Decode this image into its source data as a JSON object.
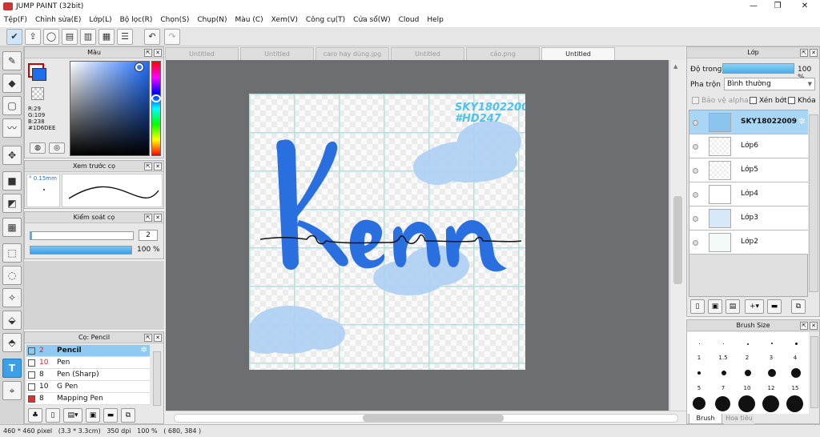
{
  "app": {
    "title": "JUMP PAINT (32bit)"
  },
  "menu": [
    "Tệp(F)",
    "Chỉnh sửa(E)",
    "Lớp(L)",
    "Bộ lọc(R)",
    "Chọn(S)",
    "Chụp(N)",
    "Màu (C)",
    "Xem(V)",
    "Công cụ(T)",
    "Cửa sổ(W)",
    "Cloud",
    "Help"
  ],
  "color_panel": {
    "title": "Màu",
    "r": "R:29",
    "g": "G:109",
    "b": "B:238",
    "hex": "#1D6DEE",
    "fg_color": "#1D6DEE",
    "bg_color": "#E23A3A"
  },
  "brush_preview": {
    "title": "Xem trước cọ",
    "size": "° 0.15mm"
  },
  "brush_control": {
    "title": "Kiểm soát cọ",
    "size_value": "2",
    "opacity_label": "100 %",
    "opacity_fraction": 1.0
  },
  "brush_list": {
    "title": "Cọ: Pencil",
    "items": [
      {
        "size": "2",
        "name": "Pencil",
        "color": "#333333",
        "selected": true
      },
      {
        "size": "10",
        "name": "Pen",
        "color": "#333333",
        "selected": false
      },
      {
        "size": "8",
        "name": "Pen (Sharp)",
        "color": "#333333",
        "selected": false
      },
      {
        "size": "10",
        "name": "G Pen",
        "color": "#333333",
        "selected": false
      },
      {
        "size": "8",
        "name": "Mapping Pen",
        "color": "#e03030",
        "selected": false
      }
    ]
  },
  "tabs": [
    {
      "label": "Untitled",
      "active": false
    },
    {
      "label": "Untitled",
      "active": false
    },
    {
      "label": "caro hay dùng.jpg",
      "active": false
    },
    {
      "label": "Untitled",
      "active": false
    },
    {
      "label": "cáo.png",
      "active": false
    },
    {
      "label": "Untitled",
      "active": true
    }
  ],
  "canvas_art": {
    "watermark_line1": "SKY18022009",
    "watermark_line2": "#HD247",
    "word": "Ken"
  },
  "layer_panel": {
    "title": "Lớp",
    "opacity_label": "Độ trong",
    "opacity_value": "100 %",
    "blend_label": "Pha trộn",
    "blend_value": "Bình thường",
    "opt_alpha": "Bảo vệ alpha",
    "opt_clip": "Xén bớt",
    "opt_lock": "Khóa",
    "layers": [
      {
        "name": "SKY18022009",
        "selected": true
      },
      {
        "name": "Lớp6",
        "selected": false
      },
      {
        "name": "Lớp5",
        "selected": false
      },
      {
        "name": "Lớp4",
        "selected": false
      },
      {
        "name": "Lớp3",
        "selected": false
      },
      {
        "name": "Lớp2",
        "selected": false
      }
    ]
  },
  "brush_size": {
    "title": "Brush Size",
    "labels": [
      "1",
      "1.5",
      "2",
      "3",
      "4",
      "5",
      "7",
      "10",
      "12",
      "15"
    ],
    "tab1": "Brush Size",
    "tab2": "Hoa tiêu"
  },
  "status": {
    "text": "460 * 460 pixel   (3.3 * 3.3cm)   350 dpi   100 %   ( 680, 384 )"
  }
}
